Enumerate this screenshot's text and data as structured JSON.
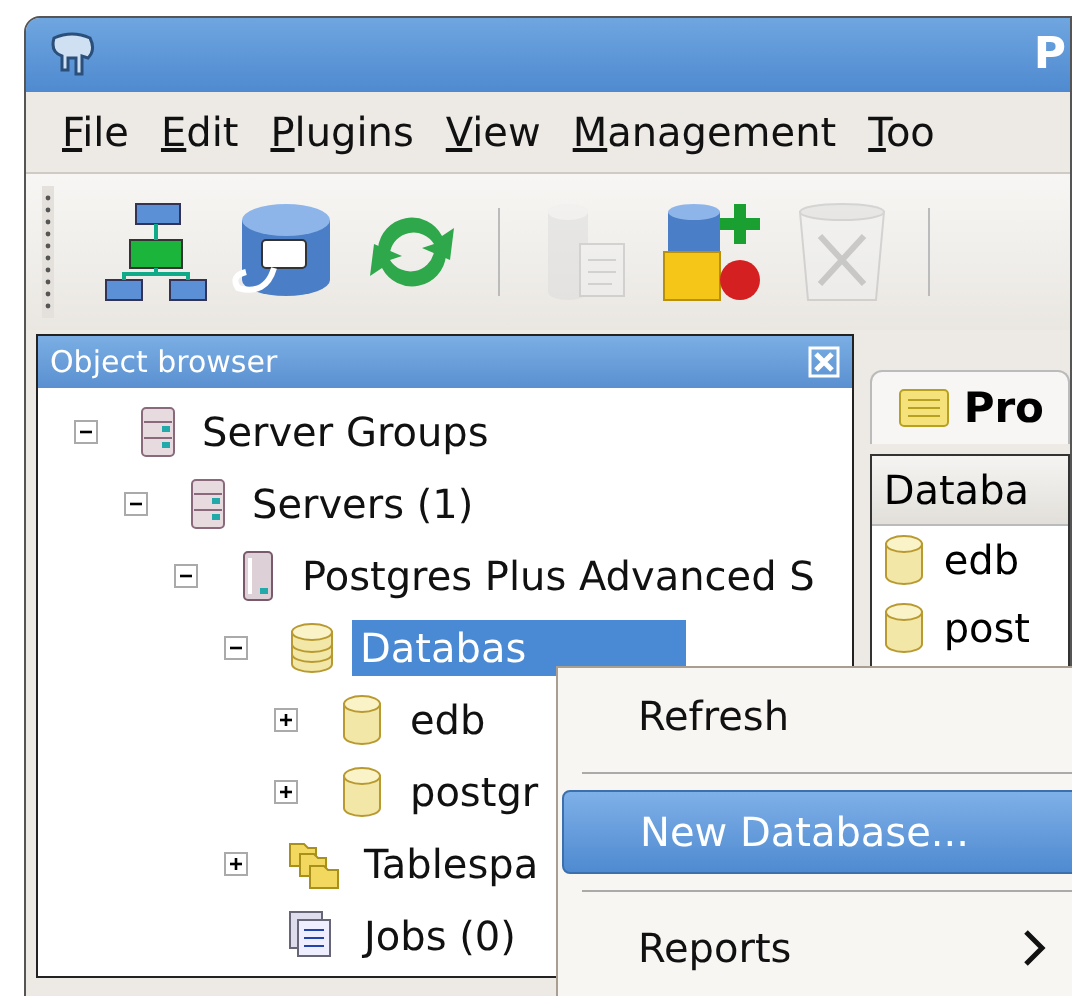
{
  "window": {
    "title": "P"
  },
  "menu_bar": [
    "File",
    "Edit",
    "Plugins",
    "View",
    "Management",
    "Too"
  ],
  "toolbar": [
    {
      "kind": "server-tree",
      "disabled": false
    },
    {
      "kind": "db-plug",
      "disabled": false
    },
    {
      "kind": "refresh",
      "disabled": false
    },
    {
      "kind": "separator"
    },
    {
      "kind": "db-script",
      "disabled": true
    },
    {
      "kind": "db-add",
      "disabled": false
    },
    {
      "kind": "trash",
      "disabled": true
    },
    {
      "kind": "separator"
    }
  ],
  "object_browser": {
    "title": "Object browser",
    "tree": [
      {
        "label": "Server Groups",
        "kind": "server-group",
        "expanded": true,
        "selected": false,
        "children": [
          {
            "label": "Servers (1)",
            "kind": "server",
            "expanded": true,
            "selected": false,
            "children": [
              {
                "label": "Postgres Plus Advanced S",
                "kind": "instance",
                "expanded": true,
                "selected": false,
                "children": [
                  {
                    "label": "Databas",
                    "kind": "databases",
                    "expanded": true,
                    "selected": true,
                    "children": [
                      {
                        "label": "edb",
                        "kind": "database",
                        "expanded": false,
                        "selected": false
                      },
                      {
                        "label": "postgr",
                        "kind": "database",
                        "expanded": false,
                        "selected": false
                      }
                    ]
                  },
                  {
                    "label": "Tablespa",
                    "kind": "tablespaces",
                    "expanded": false,
                    "selected": false
                  },
                  {
                    "label": "Jobs (0)",
                    "kind": "jobs",
                    "selected": false
                  }
                ]
              }
            ]
          }
        ]
      }
    ]
  },
  "properties": {
    "tab": {
      "label": "Pro",
      "selected": true
    },
    "column": "Databa",
    "rows": [
      "edb",
      "post"
    ]
  },
  "context_menu": [
    {
      "kind": "item",
      "label": "Refresh",
      "selected": false
    },
    {
      "kind": "separator"
    },
    {
      "kind": "item",
      "label": "New Database...",
      "selected": true
    },
    {
      "kind": "separator"
    },
    {
      "kind": "submenu",
      "label": "Reports",
      "selected": false
    }
  ]
}
